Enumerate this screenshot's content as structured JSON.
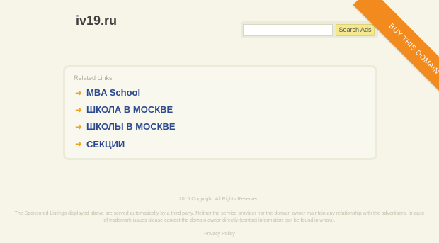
{
  "header": {
    "site_title": "iv19.ru"
  },
  "search": {
    "placeholder": "",
    "button_label": "Search Ads"
  },
  "ribbon": {
    "label": "BUY THIS DOMAIN",
    "color": "#f28a1e"
  },
  "related": {
    "heading": "Related Links",
    "items": [
      {
        "label": "MBA School",
        "icon": "arrow-right-icon"
      },
      {
        "label": "ШКОЛА В МОСКВЕ",
        "icon": "arrow-right-icon"
      },
      {
        "label": "ШКОЛЫ В МОСКВЕ",
        "icon": "arrow-right-icon"
      },
      {
        "label": "СЕКЦИИ",
        "icon": "arrow-right-icon"
      }
    ],
    "arrow_color": "#f0a21f",
    "link_color": "#2d4a8f"
  },
  "footer": {
    "copyright": "2015 Copyright. All Rights Reserved.",
    "disclaimer": "The Sponsored Listings displayed above are served automatically by a third party. Neither the service provider nor the domain owner maintain any relationship with the advertisers. In case of trademark issues please contact the domain owner directly (contact information can be found in whois).",
    "privacy_label": "Privacy Policy"
  }
}
